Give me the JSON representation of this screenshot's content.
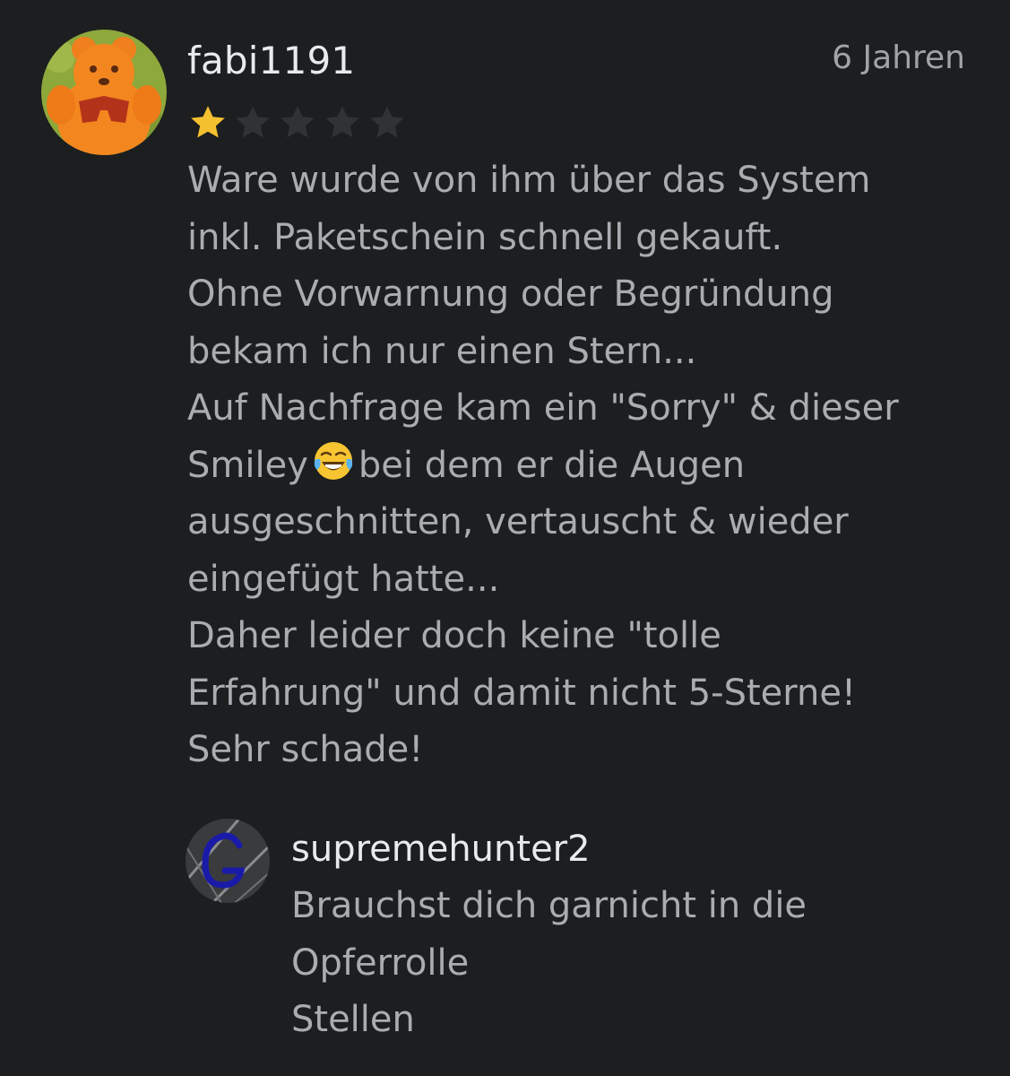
{
  "review": {
    "username": "fabi1191",
    "timestamp": "6 Jahren",
    "rating": 1,
    "rating_max": 5,
    "avatar_icon": "orange-bear-avatar-icon",
    "star_filled_color": "#f5c02f",
    "star_empty_color": "#2f3336",
    "text_lines": {
      "l1": "Ware wurde von ihm über das System",
      "l2": "inkl. Paketschein schnell gekauft.",
      "l3": "Ohne Vorwarnung oder Begründung",
      "l4": "bekam ich nur einen Stern...",
      "l5": "Auf Nachfrage kam ein \"Sorry\" & dieser",
      "l6a": "Smiley",
      "l6b": "bei dem er die Augen",
      "l7": "ausgeschnitten, vertauscht & wieder",
      "l8": "eingefügt hatte...",
      "l9": "Daher leider doch keine \"tolle",
      "l10": "Erfahrung\" und damit nicht 5-Sterne!",
      "l11": "Sehr schade!"
    },
    "emoji_icon": "face-with-tears-of-joy-icon"
  },
  "reply": {
    "username": "supremehunter2",
    "avatar_icon": "blue-g-avatar-icon",
    "text_lines": {
      "l1": "Brauchst dich garnicht in die",
      "l2": "Opferrolle",
      "l3": "Stellen"
    }
  },
  "colors": {
    "background": "#1c1e1f",
    "username": "#e9eaeb",
    "body_text": "#a9adb0"
  }
}
